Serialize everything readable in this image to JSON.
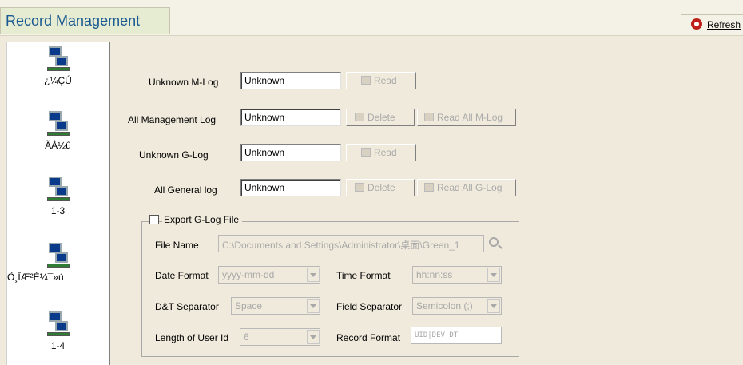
{
  "header": {
    "title": "Record Management",
    "refresh_label": "Refresh"
  },
  "sidebar": {
    "items": [
      {
        "label": "¿¼ÇÚ"
      },
      {
        "label": "ÃÅ½û"
      },
      {
        "label": "1-3"
      },
      {
        "label": "Ö¸ÎÆ²É¼¯»ú"
      },
      {
        "label": "1-4"
      }
    ]
  },
  "logs": {
    "unknown_mlog_label": "Unknown M-Log",
    "unknown_mlog_value": "Unknown",
    "all_mlog_label": "All Management Log",
    "all_mlog_value": "Unknown",
    "unknown_glog_label": "Unknown G-Log",
    "unknown_glog_value": "Unknown",
    "all_glog_label": "All General log",
    "all_glog_value": "Unknown",
    "read_label": "Read",
    "delete_label": "Delete",
    "read_all_mlog_label": "Read All M-Log",
    "read_all_glog_label": "Read All G-Log"
  },
  "export": {
    "title": "Export G-Log File",
    "checked": false,
    "file_name_label": "File Name",
    "file_name_value": "C:\\Documents and Settings\\Administrator\\桌面\\Green_1",
    "date_format_label": "Date Format",
    "date_format_value": "yyyy-mm-dd",
    "time_format_label": "Time Format",
    "time_format_value": "hh:nn:ss",
    "dt_separator_label": "D&T Separator",
    "dt_separator_value": "Space",
    "field_separator_label": "Field Separator",
    "field_separator_value": "Semicolon (;)",
    "length_user_id_label": "Length of User Id",
    "length_user_id_value": "6",
    "record_format_label": "Record Format",
    "record_format_value": "UID|DEV|DT"
  },
  "colors": {
    "title": "#1a5a92",
    "refresh_icon": "#c0201a",
    "background": "#f0eadc"
  }
}
